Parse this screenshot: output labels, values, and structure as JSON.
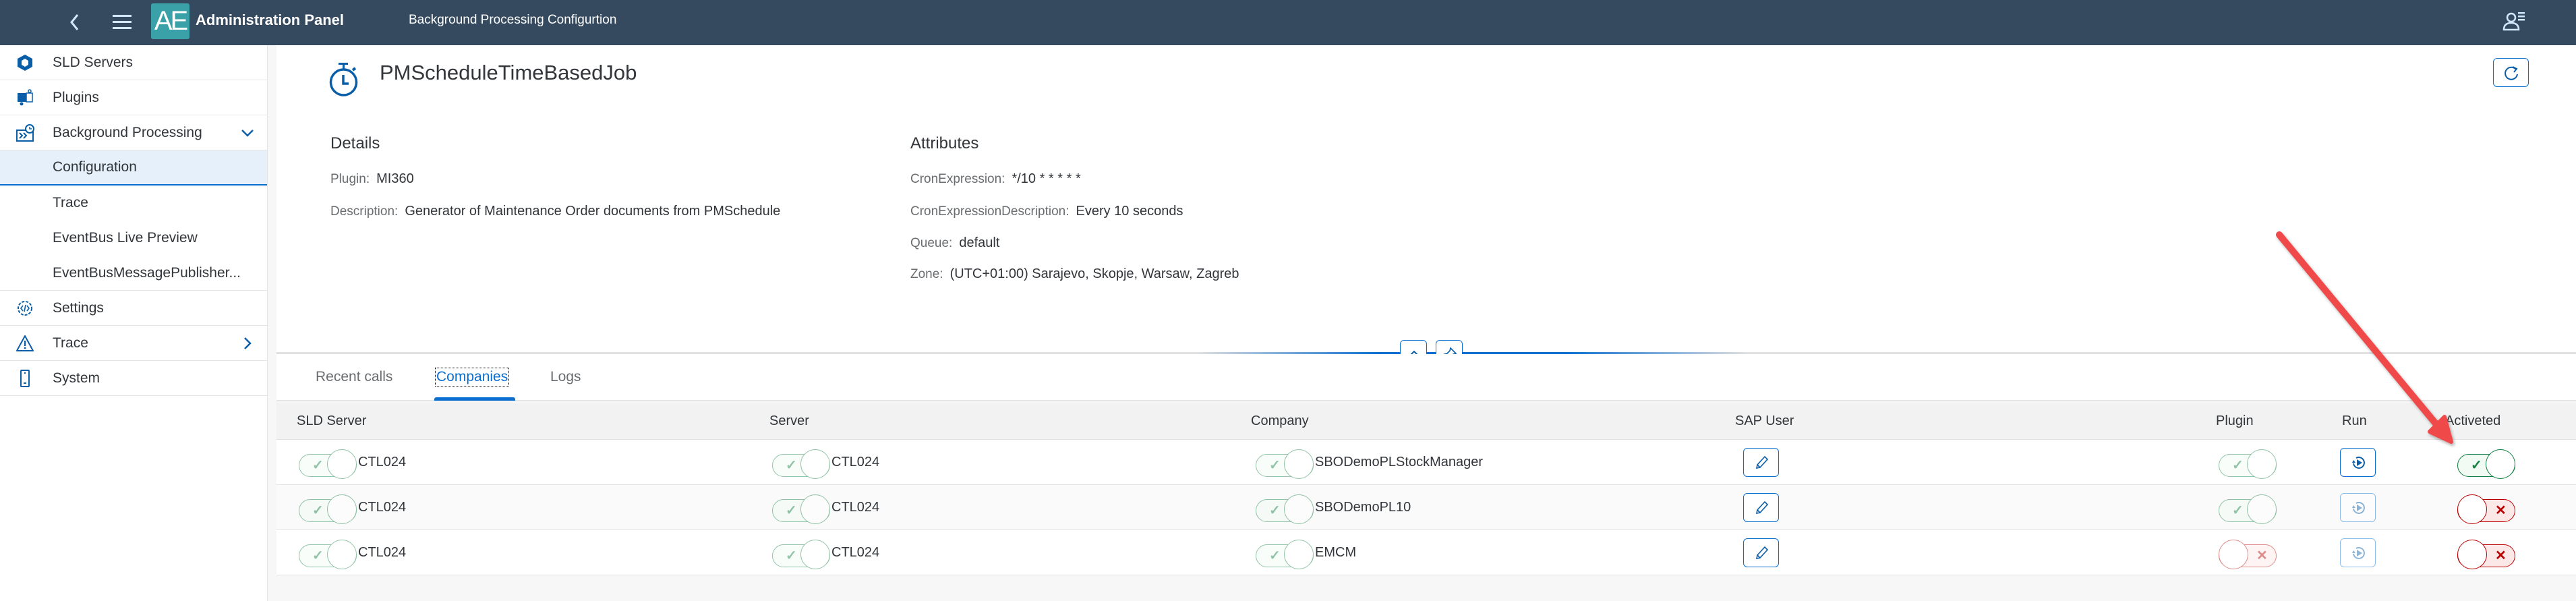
{
  "shell": {
    "logo_text": "AE",
    "app_title": "Administration Panel",
    "sub_title": "Background Processing Configurtion"
  },
  "sidebar": {
    "items": [
      {
        "label": "SLD Servers",
        "icon": "sld-servers-icon"
      },
      {
        "label": "Plugins",
        "icon": "plugins-icon"
      },
      {
        "label": "Background Processing",
        "icon": "background-processing-icon",
        "expanded": true
      },
      {
        "label": "Configuration",
        "sub": true,
        "selected": true
      },
      {
        "label": "Trace",
        "sub": true
      },
      {
        "label": "EventBus Live Preview",
        "sub": true
      },
      {
        "label": "EventBusMessagePublisher...",
        "sub": true
      },
      {
        "label": "Settings",
        "icon": "settings-icon"
      },
      {
        "label": "Trace",
        "icon": "warning-icon",
        "has_children": true
      },
      {
        "label": "System",
        "icon": "system-icon"
      }
    ]
  },
  "object": {
    "title": "PMScheduleTimeBasedJob",
    "details": {
      "heading": "Details",
      "plugin_label": "Plugin:",
      "plugin_value": "MI360",
      "description_label": "Description:",
      "description_value": "Generator of Maintenance Order documents from PMSchedule"
    },
    "attributes": {
      "heading": "Attributes",
      "cron_label": "CronExpression:",
      "cron_value": "*/10 * * * * *",
      "cron_desc_label": "CronExpressionDescription:",
      "cron_desc_value": "Every 10 seconds",
      "queue_label": "Queue:",
      "queue_value": "default",
      "zone_label": "Zone:",
      "zone_value": "(UTC+01:00) Sarajevo, Skopje, Warsaw, Zagreb"
    }
  },
  "tabs": [
    {
      "label": "Recent calls",
      "active": false
    },
    {
      "label": "Companies",
      "active": true
    },
    {
      "label": "Logs",
      "active": false
    }
  ],
  "table": {
    "columns": [
      "SLD Server",
      "Server",
      "Company",
      "SAP User",
      "Plugin",
      "Run",
      "Activeted"
    ],
    "rows": [
      {
        "sld_server": "CTL024",
        "sld_on": true,
        "server": "CTL024",
        "server_on": true,
        "company": "SBODemoPLStockManager",
        "company_on": true,
        "plugin_on": true,
        "run_enabled": true,
        "activated": true
      },
      {
        "sld_server": "CTL024",
        "sld_on": true,
        "server": "CTL024",
        "server_on": true,
        "company": "SBODemoPL10",
        "company_on": true,
        "plugin_on": true,
        "run_enabled": false,
        "activated": false
      },
      {
        "sld_server": "CTL024",
        "sld_on": true,
        "server": "CTL024",
        "server_on": true,
        "company": "EMCM",
        "company_on": true,
        "plugin_on": false,
        "run_enabled": false,
        "activated": false
      }
    ]
  },
  "colors": {
    "shell_bg": "#354a5f",
    "accent": "#0a6ed1",
    "positive": "#107e3e",
    "negative": "#bb0000",
    "annotation": "#f0484a"
  }
}
